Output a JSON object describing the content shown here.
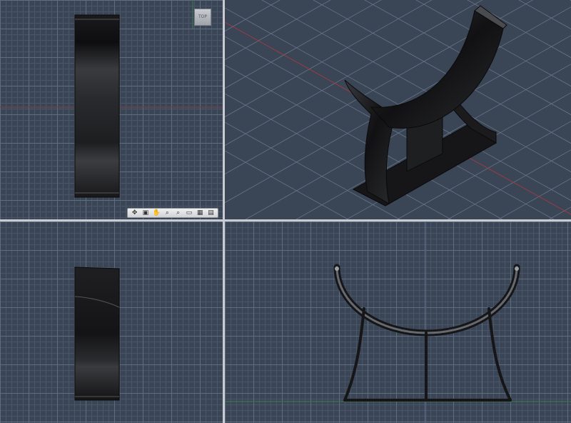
{
  "viewports": {
    "top": {
      "viewcube_label": "TOP"
    },
    "perspective": {},
    "left": {},
    "front": {}
  },
  "navbar": {
    "icons": [
      "pan-icon",
      "orbit-icon",
      "hand-icon",
      "zoom-fit-icon",
      "zoom-icon",
      "display-icon",
      "grid-icon",
      "viewports-icon"
    ],
    "glyphs": [
      "✥",
      "▣",
      "✋",
      "⌕",
      "🔍",
      "▭",
      "▦",
      "▤"
    ]
  },
  "colors": {
    "background": "#3a4555",
    "grid_major": "#5d6a7c",
    "model": "#1d1d1f",
    "axis_red": "#9b3b46",
    "axis_green": "#3b7a46"
  }
}
